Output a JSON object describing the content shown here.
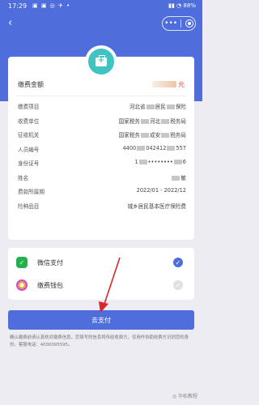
{
  "status_bar": {
    "time": "17:29",
    "left_icons": "▣ ▣ ◎ ✈ •",
    "right_text": "▮▮ ◔ 88%"
  },
  "nav": {
    "back_glyph": "‹",
    "more_glyph": "•••"
  },
  "amount": {
    "label": "缴费金额",
    "unit": "元"
  },
  "details": [
    {
      "k": "缴费项目",
      "v_pre": "河北省",
      "v_post": "居民",
      "v_end": "保险"
    },
    {
      "k": "收费单位",
      "v_pre": "国家税务",
      "v_post": "河北",
      "v_end": "税务局"
    },
    {
      "k": "征收机关",
      "v_pre": "国家税务",
      "v_post": "成安",
      "v_end": "税务局"
    },
    {
      "k": "人员编号",
      "v_pre": "4400",
      "v_post": "042412",
      "v_end": "557"
    },
    {
      "k": "身份证号",
      "v_pre": "1",
      "v_post": "••••••••",
      "v_end": "6"
    },
    {
      "k": "姓名",
      "v_pre": "",
      "v_post": "",
      "v_end": "敏"
    },
    {
      "k": "费款所属期",
      "v_pre": "",
      "v_post": "",
      "v_end": "2022/01 - 2022/12"
    },
    {
      "k": "险种品目",
      "v_pre": "",
      "v_post": "",
      "v_end": "城乡居民基本医疗保险费"
    }
  ],
  "payment": {
    "wechat": {
      "label": "微信支付",
      "selected": true
    },
    "wallet": {
      "label": "缴费钱包",
      "selected": false
    }
  },
  "pay_button": "去支付",
  "note": "确认缴费前请认真核对缴费信息，您填写的信息将传给收费方，仅用作协助收费方识别您的身份。客服电话：4000095595。",
  "watermark": "◎ 华松教程",
  "colors": {
    "primary": "#4f6edc",
    "accent_red": "#e24a4a",
    "logo_teal": "#3fc3c3",
    "wechat_green": "#22b14c"
  }
}
